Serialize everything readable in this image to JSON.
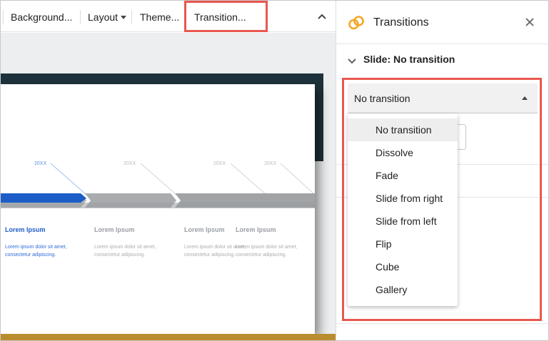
{
  "toolbar": {
    "items": [
      {
        "label": "Background...",
        "has_caret": false
      },
      {
        "label": "Layout",
        "has_caret": true
      },
      {
        "label": "Theme...",
        "has_caret": false
      },
      {
        "label": "Transition...",
        "has_caret": false
      }
    ],
    "collapse_icon": "chevron-up-icon",
    "highlighted_item": "Transition..."
  },
  "slide": {
    "timeline": [
      {
        "year": "20XX",
        "heading": "Lorem Ipsum",
        "body": "Lorem ipsum dolor sit amet, consectetur adipiscing.",
        "active": true
      },
      {
        "year": "20XX",
        "heading": "Lorem Ipsum",
        "body": "Lorem ipsum dolor sit amet, consectetur adipiscing.",
        "active": false
      },
      {
        "year": "20XX",
        "heading": "Lorem Ipsum",
        "body": "Lorem ipsum dolor sit amet, consectetur adipiscing.",
        "active": false
      },
      {
        "year": "20XX",
        "heading": "Lorem Ipsum",
        "body": "Lorem ipsum dolor sit amet, consectetur adipiscing.",
        "active": false
      }
    ]
  },
  "panel": {
    "title": "Transitions",
    "title_icon": "transitions-icon",
    "close_icon": "close-icon",
    "section_label": "Slide: No transition",
    "dropdown": {
      "selected": "No transition",
      "options": [
        "No transition",
        "Dissolve",
        "Fade",
        "Slide from right",
        "Slide from left",
        "Flip",
        "Cube",
        "Gallery"
      ]
    }
  },
  "colors": {
    "highlight": "#e8584f",
    "icon_orange": "#f6a623",
    "timeline_blue": "#1c5dc7",
    "slide_dark": "#1d323c",
    "slide_accent": "#b98d2f"
  }
}
